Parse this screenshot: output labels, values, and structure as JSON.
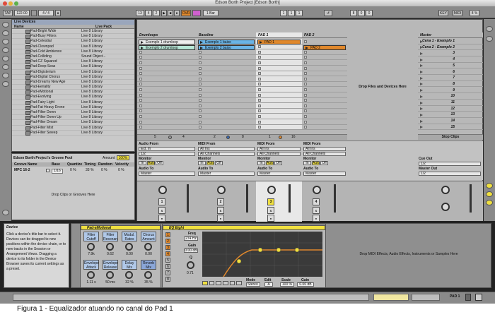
{
  "window": {
    "title": "Edson Borth Project  [Edson Borth]"
  },
  "transport": {
    "tap": "TAP",
    "tempo": "122.00",
    "time_sig": "4 / 4",
    "bar_pos": "13",
    "beat_pos": "4",
    "sub_pos": "2",
    "ovr": "OVR",
    "quantize": "1 Bar",
    "loop_start": "1",
    "loop_a": "1",
    "loop_b": "1",
    "loop_len_a": "8",
    "loop_len_b": "0",
    "loop_len_c": "0",
    "key": "KEY",
    "midi": "MIDI",
    "cpu": "8 %"
  },
  "browser": {
    "title": "Live Devices",
    "col_name": "Name",
    "col_location": "Live Pack",
    "rows": [
      {
        "name": "Pad-Bright Wide",
        "loc": "Live 8 Library"
      },
      {
        "name": "Pad-Busy Filters",
        "loc": "Live 8 Library"
      },
      {
        "name": "Pad-Celestial",
        "loc": "Live 8 Library"
      },
      {
        "name": "Pad-Clownpad",
        "loc": "Live 8 Library"
      },
      {
        "name": "Pad-Cold Ambience",
        "loc": "Live 8 Library"
      },
      {
        "name": "Pad-Colliding",
        "loc": "Sound Object..."
      },
      {
        "name": "Pad-CZ Squared",
        "loc": "Live 8 Library"
      },
      {
        "name": "Pad-Deep Seas",
        "loc": "Live 8 Library"
      },
      {
        "name": "Pad-Digisterium",
        "loc": "Live 8 Library"
      },
      {
        "name": "Pad-Digital Chorus",
        "loc": "Live 8 Library"
      },
      {
        "name": "Pad-Dreamy New Age",
        "loc": "Live 8 Library"
      },
      {
        "name": "Pad-Eeriality",
        "loc": "Live 8 Library"
      },
      {
        "name": "Pad-eMotional",
        "loc": "Live 8 Library"
      },
      {
        "name": "Pad-Evolving",
        "loc": "Live 8 Library"
      },
      {
        "name": "Pad-Fairy Light",
        "loc": "Live 8 Library"
      },
      {
        "name": "Pad-Fat Heavy Drone",
        "loc": "Live 8 Library"
      },
      {
        "name": "Pad-Filter Down",
        "loc": "Live 8 Library"
      },
      {
        "name": "Pad-Filter Down Up",
        "loc": "Live 8 Library"
      },
      {
        "name": "Pad-Filter Dream",
        "loc": "Live 8 Library"
      },
      {
        "name": "Pad-Filter Mist",
        "loc": "Live 8 Library"
      },
      {
        "name": "Pad-Filter Sweep",
        "loc": "Live 8 Library"
      }
    ]
  },
  "groove": {
    "title": "Edson Borth Project's Groove Pool",
    "amount_label": "Amount",
    "amount_value": "100%",
    "cols": [
      "Groove Name",
      "Base",
      "Quantize",
      "Timing",
      "Random",
      "Velocity"
    ],
    "row": {
      "name": "MPC 16-2",
      "base": "1/16",
      "quantize": "0 %",
      "timing": "33 %",
      "random": "0 %",
      "velocity": "0 %"
    },
    "drop_hint": "Drop Clips or Grooves Here"
  },
  "session": {
    "tracks": [
      {
        "name": "Drumloops",
        "color": "#9ad39a",
        "clips": [
          "Exemplo 1 drumloop",
          "Exemplo 2 drumloop"
        ],
        "io_from": "Audio From",
        "from_val": "Ext. In",
        "chan_val": "1/2",
        "to_val": "Master",
        "num": "1",
        "bottom_a": "5",
        "bottom_b": "4"
      },
      {
        "name": "Baseline",
        "color": "#6ab4e6",
        "clips": [
          "Exemplo 1 baixo",
          "Exemplo 2 baixo"
        ],
        "io_from": "MIDI From",
        "from_val": "All Ins",
        "chan_val": "All Channels",
        "to_val": "Master",
        "num": "2",
        "bottom_a": "2",
        "bottom_b": "8"
      },
      {
        "name": "PAD 1",
        "color": "#e0882c",
        "clips": [
          "PAD 1",
          ""
        ],
        "io_from": "MIDI From",
        "from_val": "All Ins",
        "chan_val": "All Channels",
        "to_val": "Master",
        "num": "3",
        "bottom_a": "1",
        "bottom_b": "16"
      },
      {
        "name": "PAD 2",
        "color": "#e0882c",
        "clips": [
          "",
          "PAD 2"
        ],
        "io_from": "MIDI From",
        "from_val": "All Ins",
        "chan_val": "All Channels",
        "to_val": "Master",
        "num": "4",
        "bottom_a": "",
        "bottom_b": ""
      }
    ],
    "monitor_label": "Monitor",
    "monitor_opts": [
      "In",
      "Auto",
      "Off"
    ],
    "audio_to": "Audio To",
    "drop_hint": "Drop Files and Devices Here",
    "master": {
      "name": "Master",
      "scenes": [
        "Cena 1 - Exemplo 1",
        "Cena 2 - Exemplo 2",
        "3",
        "4",
        "5",
        "6",
        "7",
        "8",
        "9",
        "10",
        "11",
        "12",
        "13",
        "14",
        "15"
      ],
      "stop_clips": "Stop Clips",
      "cue_out": "Cue Out",
      "cue_val": "1/2",
      "master_out": "Master Out",
      "master_val": "1/2"
    }
  },
  "info": {
    "title": "Device",
    "text": "Click a device's title bar to select it. Devices can be dragged to new positions within the device chain, or to new tracks in the Session or Arrangement Views. Dragging a device to its folder in the Device Browser saves its current settings as a preset."
  },
  "devices": {
    "pad": {
      "title": "Pad-eMotional",
      "macros": [
        {
          "label": "Filter Cutoff",
          "value": "7.9k"
        },
        {
          "label": "Filter Resonan",
          "value": "0.62"
        },
        {
          "label": "Modul. Rates",
          "value": "0.00"
        },
        {
          "label": "Chorus Amount",
          "value": "0.00"
        },
        {
          "label": "Envelope Attack",
          "value": "1.11 s"
        },
        {
          "label": "Envelope Release",
          "value": "50 ms"
        },
        {
          "label": "Delay Mix",
          "value": "32 %"
        },
        {
          "label": "Reverb Mix",
          "value": "35 %"
        }
      ]
    },
    "eq": {
      "title": "EQ Eight",
      "freq_label": "Freq",
      "freq_value": "274 Hz",
      "gain_label": "Gain",
      "gain_value": "0.00 dB",
      "q_label": "Q",
      "q_value": "0.71",
      "band_nums": [
        "1",
        "2",
        "3",
        "4",
        "5",
        "6",
        "7",
        "8"
      ],
      "mode_label": "Mode",
      "mode_value": "Stereo",
      "edit_label": "Edit",
      "edit_value": "A",
      "scale_label": "Scale",
      "scale_value": "100 %",
      "gain2_label": "Gain",
      "gain2_value": "0.00 dB"
    },
    "drop_hint": "Drop MIDI Effects, Audio Effects, Instruments or Samples Here"
  },
  "statusbar": {
    "track": "PAD 1"
  },
  "caption": "Figura 1 - Equalizador atuando no canal do Pad 1"
}
